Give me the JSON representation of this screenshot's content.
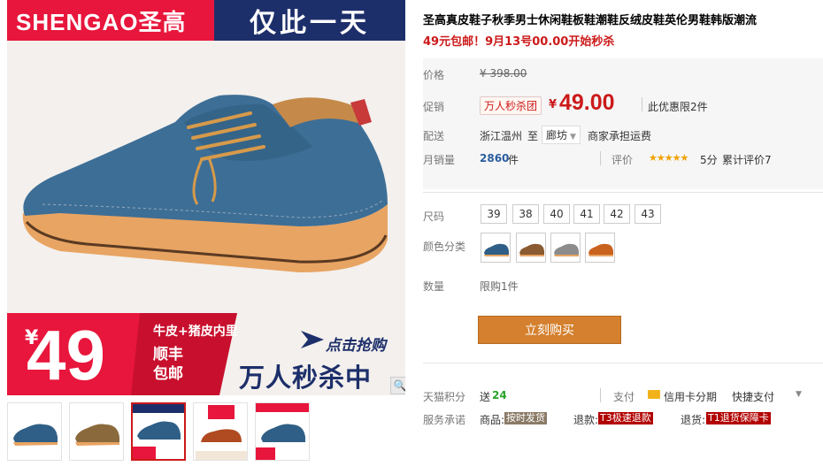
{
  "hero": {
    "brand": "SHENGAO圣高",
    "tag": "仅此一天",
    "promo": {
      "yen": "¥",
      "price": "49",
      "line1": "牛皮+猪皮内里",
      "line2a": "顺丰",
      "line2b": "包邮",
      "click": "点击抢购",
      "kill": "万人秒杀中"
    },
    "zoom_icon": "magnifier-icon"
  },
  "thumbs": [
    {
      "color": "#2f5f86",
      "selected": false
    },
    {
      "color": "#8a6a3c",
      "selected": false
    },
    {
      "color": "#2f5f86",
      "selected": true
    },
    {
      "color": "#b04a20",
      "selected": false
    },
    {
      "color": "#2f5f86",
      "selected": false
    }
  ],
  "product": {
    "title": "圣高真皮鞋子秋季男士休闲鞋板鞋潮鞋反绒皮鞋英伦男鞋韩版潮流",
    "subtitle": "49元包邮！9月13号00.00开始秒杀"
  },
  "price": {
    "label": "价格",
    "old": "¥ 398.00",
    "promo_label": "促销",
    "promo_badge": "万人秒杀团",
    "yen": "¥",
    "current": "49.00",
    "limit": "此优惠限2件",
    "ship_label": "配送",
    "ship_from": "浙江温州",
    "ship_to_word": "至",
    "ship_to": "廊坊",
    "ship_note": "商家承担运费",
    "sales_label": "月销量",
    "sales_count": "2860",
    "sales_unit": "件",
    "rating_label": "评价",
    "stars": "★★★★★",
    "score": "5分",
    "cumulative": "累计评价7"
  },
  "size": {
    "label": "尺码",
    "options": [
      "39",
      "38",
      "40",
      "41",
      "42",
      "43"
    ]
  },
  "color": {
    "label": "颜色分类",
    "options": [
      "#2f5f86",
      "#8a5a30",
      "#8c8c8c",
      "#c8621e"
    ]
  },
  "quantity": {
    "label": "数量",
    "note": "限购1件"
  },
  "buy": {
    "label": "立刻购买"
  },
  "tmall": {
    "points_label": "天猫积分",
    "points_prefix": "送",
    "points_value": "24",
    "pay_label": "支付",
    "credit": "信用卡分期",
    "fast": "快捷支付",
    "service_label": "服务承诺",
    "goods": "商品:",
    "goods_tag": "按时发货",
    "refund": "退款:",
    "refund_tag": "T3极速退款",
    "return": "退货:",
    "return_tag": "T1退货保障卡"
  }
}
